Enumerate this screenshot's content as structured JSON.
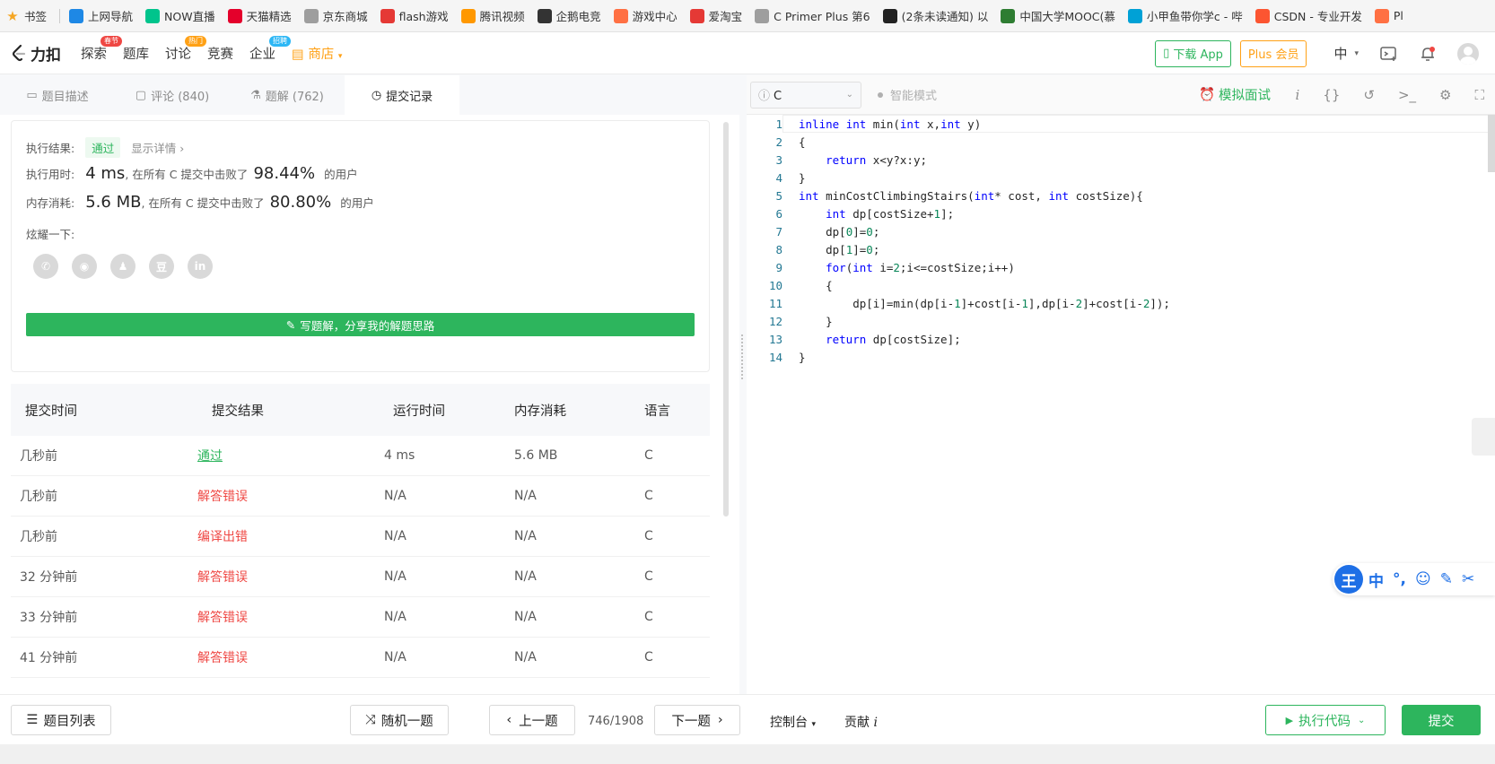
{
  "bookmarks": [
    {
      "label": "书签",
      "icon": "star-icon",
      "color": "#f5a623"
    },
    {
      "label": "上网导航",
      "icon": "ie-icon",
      "color": "#1e88e5"
    },
    {
      "label": "NOW直播",
      "icon": "now-icon",
      "color": "#00c48c"
    },
    {
      "label": "天猫精选",
      "icon": "tmall-icon",
      "color": "#e4002b"
    },
    {
      "label": "京东商城",
      "icon": "globe-icon",
      "color": "#9e9e9e"
    },
    {
      "label": "flash游戏",
      "icon": "flash-icon",
      "color": "#e53935"
    },
    {
      "label": "腾讯视频",
      "icon": "tencent-video-icon",
      "color": "#ff9800"
    },
    {
      "label": "企鹅电竞",
      "icon": "penguin-icon",
      "color": "#333333"
    },
    {
      "label": "游戏中心",
      "icon": "gamepad-icon",
      "color": "#ff7043"
    },
    {
      "label": "爱淘宝",
      "icon": "taobao-icon",
      "color": "#e53935"
    },
    {
      "label": "C Primer Plus 第6",
      "icon": "globe-icon",
      "color": "#9e9e9e"
    },
    {
      "label": "(2条未读通知) 以",
      "icon": "csdn-dark-icon",
      "color": "#222222"
    },
    {
      "label": "中国大学MOOC(慕",
      "icon": "mooc-icon",
      "color": "#2e7d32"
    },
    {
      "label": "小甲鱼带你学c - 哔",
      "icon": "bilibili-icon",
      "color": "#00a1d6"
    },
    {
      "label": "CSDN - 专业开发",
      "icon": "csdn-icon",
      "color": "#fc5531"
    },
    {
      "label": "Pl",
      "icon": "pencil-icon",
      "color": "#ff7043"
    }
  ],
  "navbar": {
    "logo": "力扣",
    "items": [
      {
        "label": "探索",
        "badge": "春节",
        "badge_color": "#ef4743"
      },
      {
        "label": "题库",
        "badge": "",
        "badge_color": ""
      },
      {
        "label": "讨论",
        "badge": "热门",
        "badge_color": "#ffa116"
      },
      {
        "label": "竞赛",
        "badge": "",
        "badge_color": ""
      },
      {
        "label": "企业",
        "badge": "招聘",
        "badge_color": "#2db7f5"
      }
    ],
    "shop": "商店",
    "download_app": "下载 App",
    "plus": "Plus 会员",
    "lang": "中"
  },
  "tabs": [
    {
      "label": "题目描述",
      "icon": "doc-icon"
    },
    {
      "label": "评论 (840)",
      "icon": "comment-icon"
    },
    {
      "label": "题解 (762)",
      "icon": "flask-icon"
    },
    {
      "label": "提交记录",
      "icon": "clock-icon"
    }
  ],
  "result": {
    "status_label": "执行结果:",
    "status": "通过",
    "details": "显示详情",
    "time_label": "执行用时:",
    "time_value": "4 ms",
    "time_text": ", 在所有 C 提交中击败了",
    "time_pct": "98.44%",
    "user_text": "的用户",
    "mem_label": "内存消耗:",
    "mem_value": "5.6 MB",
    "mem_text": ", 在所有 C 提交中击败了",
    "mem_pct": "80.80%",
    "share_label": "炫耀一下:",
    "share_icons": [
      "wechat-icon",
      "weibo-icon",
      "qq-icon",
      "douban-icon",
      "linkedin-icon"
    ],
    "write_solution": "写题解，分享我的解题思路"
  },
  "table": {
    "headers": [
      "提交时间",
      "提交结果",
      "运行时间",
      "内存消耗",
      "语言"
    ],
    "rows": [
      {
        "time": "几秒前",
        "result": "通过",
        "runtime": "4 ms",
        "memory": "5.6 MB",
        "lang": "C",
        "passed": true
      },
      {
        "time": "几秒前",
        "result": "解答错误",
        "runtime": "N/A",
        "memory": "N/A",
        "lang": "C",
        "passed": false
      },
      {
        "time": "几秒前",
        "result": "编译出错",
        "runtime": "N/A",
        "memory": "N/A",
        "lang": "C",
        "passed": false
      },
      {
        "time": "32 分钟前",
        "result": "解答错误",
        "runtime": "N/A",
        "memory": "N/A",
        "lang": "C",
        "passed": false
      },
      {
        "time": "33 分钟前",
        "result": "解答错误",
        "runtime": "N/A",
        "memory": "N/A",
        "lang": "C",
        "passed": false
      },
      {
        "time": "41 分钟前",
        "result": "解答错误",
        "runtime": "N/A",
        "memory": "N/A",
        "lang": "C",
        "passed": false
      }
    ]
  },
  "editor": {
    "language": "C",
    "smart_mode": "智能模式",
    "mock_interview": "模拟面试",
    "lines": [
      "inline int min(int x,int y)",
      "{",
      "    return x<y?x:y;",
      "}",
      "int minCostClimbingStairs(int* cost, int costSize){",
      "    int dp[costSize+1];",
      "    dp[0]=0;",
      "    dp[1]=0;",
      "    for(int i=2;i<=costSize;i++)",
      "    {",
      "        dp[i]=min(dp[i-1]+cost[i-1],dp[i-2]+cost[i-2]);",
      "    }",
      "    return dp[costSize];",
      "}"
    ]
  },
  "ime": {
    "items": [
      "王",
      "中",
      "°,",
      "☺",
      "✎",
      "✂"
    ]
  },
  "bottom": {
    "problem_list": "题目列表",
    "random": "随机一题",
    "prev": "上一题",
    "pager": "746/1908",
    "next": "下一题",
    "console": "控制台",
    "contribute": "贡献",
    "run": "执行代码",
    "submit": "提交"
  }
}
